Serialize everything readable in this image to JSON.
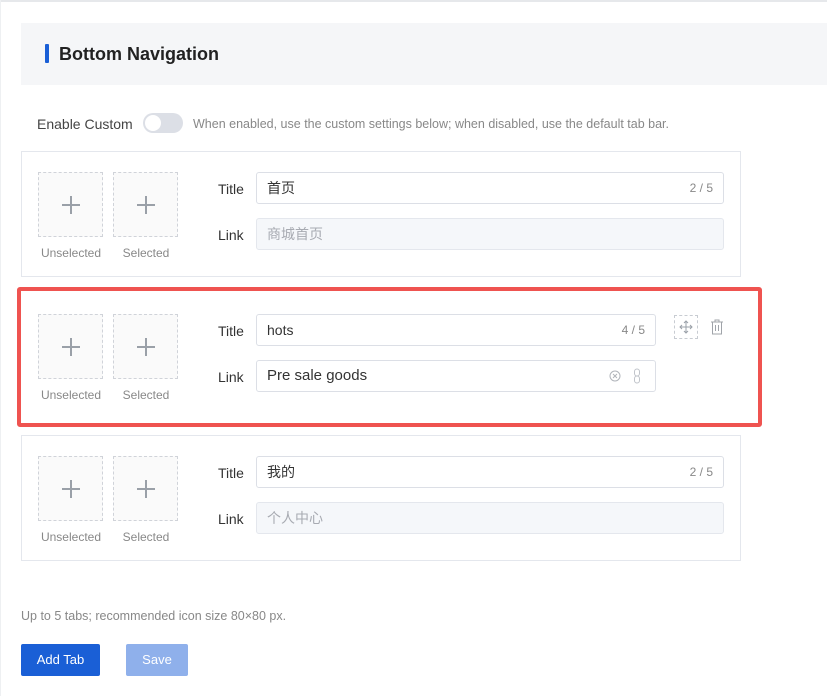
{
  "header": {
    "title": "Bottom Navigation"
  },
  "custom": {
    "label": "Enable Custom",
    "hint": "When enabled, use the custom settings below; when disabled, use the default tab bar."
  },
  "labels": {
    "unselected": "Unselected",
    "selected": "Selected",
    "title": "Title",
    "link": "Link"
  },
  "tabs": [
    {
      "title": "首页",
      "count": "2 / 5",
      "link_placeholder": "商城首页",
      "link_value": ""
    },
    {
      "title": "hots",
      "count": "4 / 5",
      "link_placeholder": "",
      "link_value": "Pre sale goods"
    },
    {
      "title": "我的",
      "count": "2 / 5",
      "link_placeholder": "个人中心",
      "link_value": ""
    }
  ],
  "footer": {
    "hint": "Up to 5 tabs; recommended icon size 80×80 px.",
    "add_label": "Add Tab",
    "save_label": "Save"
  },
  "colors": {
    "accent": "#1a5fd6",
    "highlight": "#ef5350",
    "disabled_button": "#8fb0eb"
  }
}
